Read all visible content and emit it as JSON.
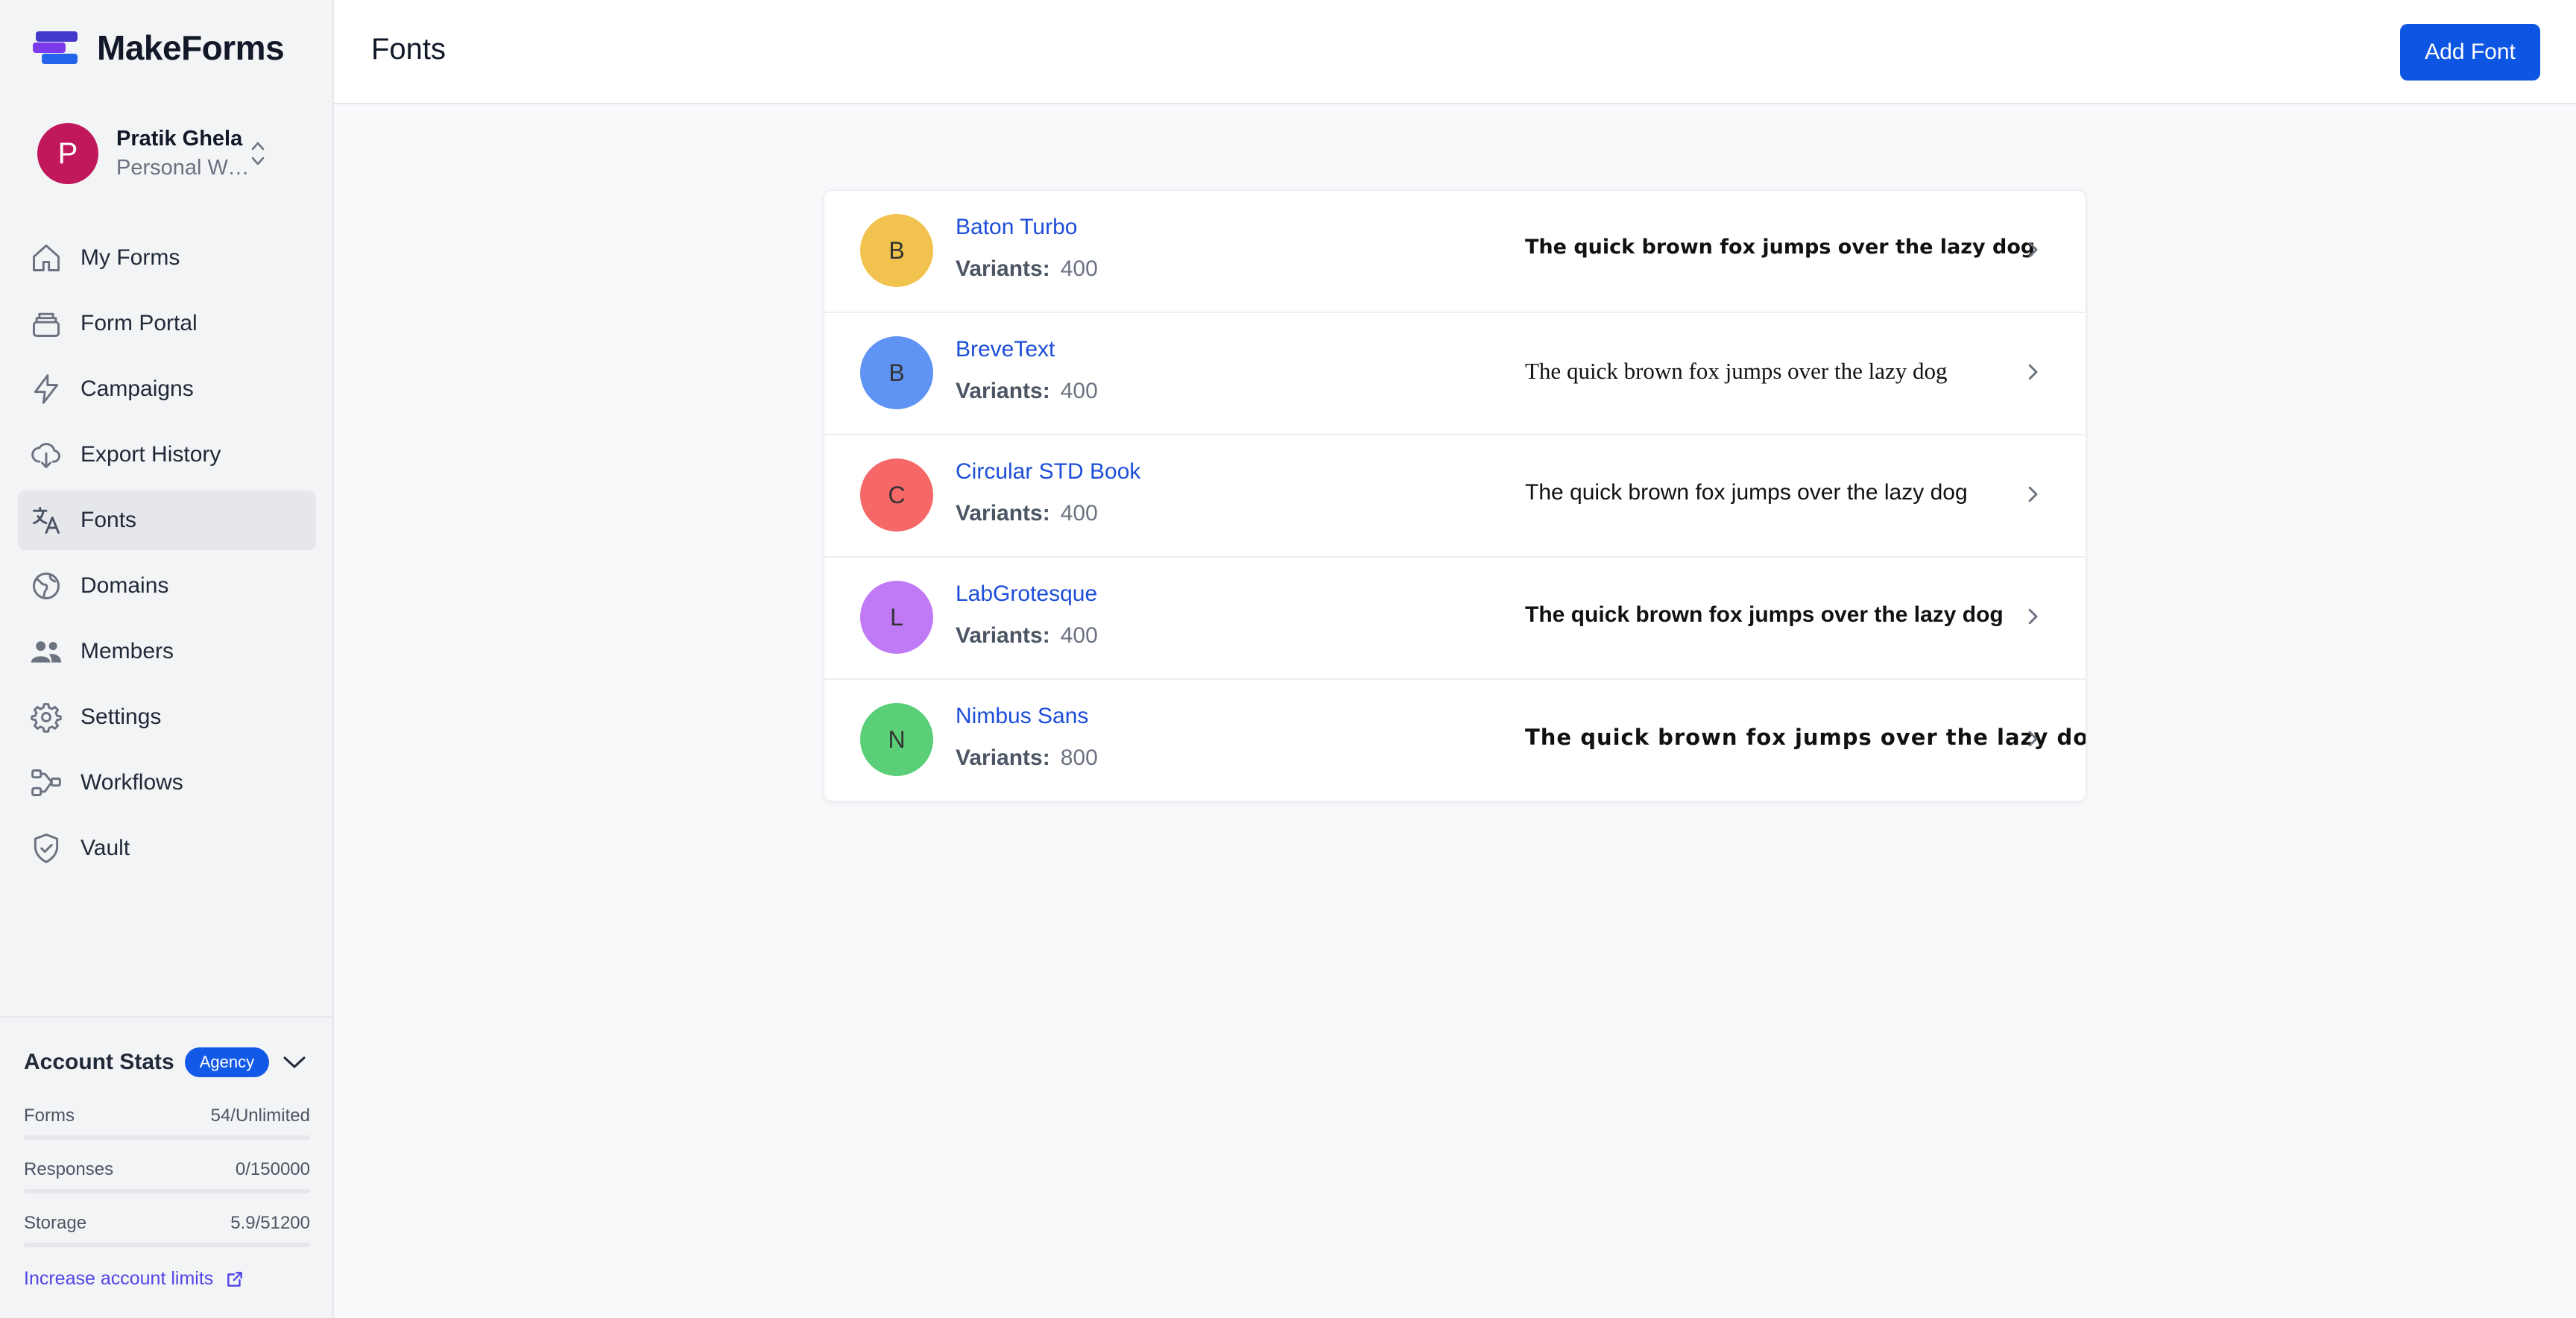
{
  "app": {
    "name": "MakeForms"
  },
  "user": {
    "initial": "P",
    "name": "Pratik Ghela",
    "workspace": "Personal Workspace"
  },
  "nav": [
    {
      "label": "My Forms",
      "icon": "home-icon",
      "name": "nav-my-forms"
    },
    {
      "label": "Form Portal",
      "icon": "portal-icon",
      "name": "nav-form-portal"
    },
    {
      "label": "Campaigns",
      "icon": "lightning-icon",
      "name": "nav-campaigns"
    },
    {
      "label": "Export History",
      "icon": "cloud-download-icon",
      "name": "nav-export-history"
    },
    {
      "label": "Fonts",
      "icon": "translate-icon",
      "name": "nav-fonts"
    },
    {
      "label": "Domains",
      "icon": "globe-icon",
      "name": "nav-domains"
    },
    {
      "label": "Members",
      "icon": "users-icon",
      "name": "nav-members"
    },
    {
      "label": "Settings",
      "icon": "gear-icon",
      "name": "nav-settings"
    },
    {
      "label": "Workflows",
      "icon": "workflow-icon",
      "name": "nav-workflows"
    },
    {
      "label": "Vault",
      "icon": "shield-check-icon",
      "name": "nav-vault"
    }
  ],
  "active_nav": "Fonts",
  "account_stats": {
    "title": "Account Stats",
    "plan_badge": "Agency",
    "items": [
      {
        "label": "Forms",
        "value": "54/Unlimited",
        "fill": 0
      },
      {
        "label": "Responses",
        "value": "0/150000",
        "fill": 0
      },
      {
        "label": "Storage",
        "value": "5.9/51200",
        "fill": 0
      }
    ],
    "increase_link": "Increase account limits"
  },
  "page": {
    "title": "Fonts",
    "add_button": "Add Font"
  },
  "fonts": [
    {
      "initial": "B",
      "name": "Baton Turbo",
      "variants_label": "Variants:",
      "variants": "400",
      "preview": "The quick brown fox jumps over the lazy dog",
      "color": "#f1c24e"
    },
    {
      "initial": "B",
      "name": "BreveText",
      "variants_label": "Variants:",
      "variants": "400",
      "preview": "The quick brown fox jumps over the lazy dog",
      "color": "#5f93f4"
    },
    {
      "initial": "C",
      "name": "Circular STD Book",
      "variants_label": "Variants:",
      "variants": "400",
      "preview": "The quick brown fox jumps over the lazy dog",
      "color": "#f66767"
    },
    {
      "initial": "L",
      "name": "LabGrotesque",
      "variants_label": "Variants:",
      "variants": "400",
      "preview": "The quick brown fox jumps over the lazy dog",
      "color": "#c07af5"
    },
    {
      "initial": "N",
      "name": "Nimbus Sans",
      "variants_label": "Variants:",
      "variants": "800",
      "preview": "The quick brown fox jumps over the lazy dog",
      "color": "#5bcf78"
    }
  ],
  "colors": {
    "accent": "#0d55e3",
    "link": "#1d4ed8",
    "avatar": "#c0185a"
  }
}
